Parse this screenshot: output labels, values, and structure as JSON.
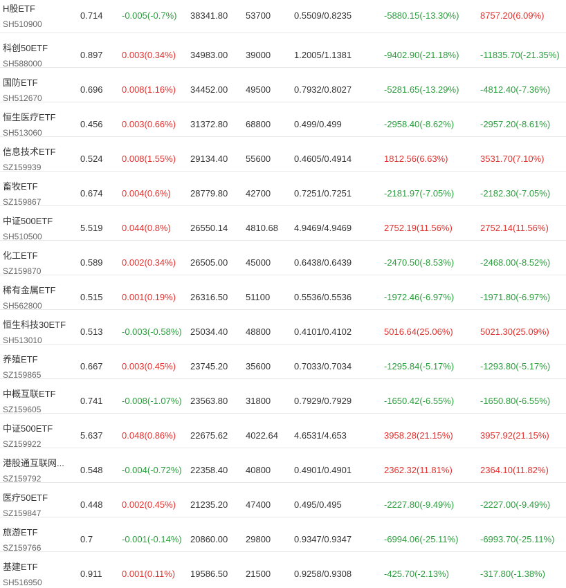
{
  "colors": {
    "up": "#e0312e",
    "down": "#2a9d3c",
    "text": "#333333",
    "subtext": "#666666",
    "divider": "#e8e8e8"
  },
  "rows": [
    {
      "name": "H股ETF",
      "code": "SH510900",
      "price": "0.714",
      "change": "-0.005(-0.7%)",
      "change_dir": "down",
      "amount": "38341.80",
      "volume": "53700",
      "ratio": "0.5509/0.8235",
      "pnl1": "-5880.15(-13.30%)",
      "pnl1_dir": "down",
      "pnl2": "8757.20(6.09%)",
      "pnl2_dir": "up"
    },
    {
      "name": "科创50ETF",
      "code": "SH588000",
      "price": "0.897",
      "change": "0.003(0.34%)",
      "change_dir": "up",
      "amount": "34983.00",
      "volume": "39000",
      "ratio": "1.2005/1.1381",
      "pnl1": "-9402.90(-21.18%)",
      "pnl1_dir": "down",
      "pnl2": "-11835.70(-21.35%)",
      "pnl2_dir": "down"
    },
    {
      "name": "国防ETF",
      "code": "SH512670",
      "price": "0.696",
      "change": "0.008(1.16%)",
      "change_dir": "up",
      "amount": "34452.00",
      "volume": "49500",
      "ratio": "0.7932/0.8027",
      "pnl1": "-5281.65(-13.29%)",
      "pnl1_dir": "down",
      "pnl2": "-4812.40(-7.36%)",
      "pnl2_dir": "down"
    },
    {
      "name": "恒生医疗ETF",
      "code": "SH513060",
      "price": "0.456",
      "change": "0.003(0.66%)",
      "change_dir": "up",
      "amount": "31372.80",
      "volume": "68800",
      "ratio": "0.499/0.499",
      "pnl1": "-2958.40(-8.62%)",
      "pnl1_dir": "down",
      "pnl2": "-2957.20(-8.61%)",
      "pnl2_dir": "down"
    },
    {
      "name": "信息技术ETF",
      "code": "SZ159939",
      "price": "0.524",
      "change": "0.008(1.55%)",
      "change_dir": "up",
      "amount": "29134.40",
      "volume": "55600",
      "ratio": "0.4605/0.4914",
      "pnl1": "1812.56(6.63%)",
      "pnl1_dir": "up",
      "pnl2": "3531.70(7.10%)",
      "pnl2_dir": "up"
    },
    {
      "name": "畜牧ETF",
      "code": "SZ159867",
      "price": "0.674",
      "change": "0.004(0.6%)",
      "change_dir": "up",
      "amount": "28779.80",
      "volume": "42700",
      "ratio": "0.7251/0.7251",
      "pnl1": "-2181.97(-7.05%)",
      "pnl1_dir": "down",
      "pnl2": "-2182.30(-7.05%)",
      "pnl2_dir": "down"
    },
    {
      "name": "中证500ETF",
      "code": "SH510500",
      "price": "5.519",
      "change": "0.044(0.8%)",
      "change_dir": "up",
      "amount": "26550.14",
      "volume": "4810.68",
      "ratio": "4.9469/4.9469",
      "pnl1": "2752.19(11.56%)",
      "pnl1_dir": "up",
      "pnl2": "2752.14(11.56%)",
      "pnl2_dir": "up"
    },
    {
      "name": "化工ETF",
      "code": "SZ159870",
      "price": "0.589",
      "change": "0.002(0.34%)",
      "change_dir": "up",
      "amount": "26505.00",
      "volume": "45000",
      "ratio": "0.6438/0.6439",
      "pnl1": "-2470.50(-8.53%)",
      "pnl1_dir": "down",
      "pnl2": "-2468.00(-8.52%)",
      "pnl2_dir": "down"
    },
    {
      "name": "稀有金属ETF",
      "code": "SH562800",
      "price": "0.515",
      "change": "0.001(0.19%)",
      "change_dir": "up",
      "amount": "26316.50",
      "volume": "51100",
      "ratio": "0.5536/0.5536",
      "pnl1": "-1972.46(-6.97%)",
      "pnl1_dir": "down",
      "pnl2": "-1971.80(-6.97%)",
      "pnl2_dir": "down"
    },
    {
      "name": "恒生科技30ETF",
      "code": "SH513010",
      "price": "0.513",
      "change": "-0.003(-0.58%)",
      "change_dir": "down",
      "amount": "25034.40",
      "volume": "48800",
      "ratio": "0.4101/0.4102",
      "pnl1": "5016.64(25.06%)",
      "pnl1_dir": "up",
      "pnl2": "5021.30(25.09%)",
      "pnl2_dir": "up"
    },
    {
      "name": "养殖ETF",
      "code": "SZ159865",
      "price": "0.667",
      "change": "0.003(0.45%)",
      "change_dir": "up",
      "amount": "23745.20",
      "volume": "35600",
      "ratio": "0.7033/0.7034",
      "pnl1": "-1295.84(-5.17%)",
      "pnl1_dir": "down",
      "pnl2": "-1293.80(-5.17%)",
      "pnl2_dir": "down"
    },
    {
      "name": "中概互联ETF",
      "code": "SZ159605",
      "price": "0.741",
      "change": "-0.008(-1.07%)",
      "change_dir": "down",
      "amount": "23563.80",
      "volume": "31800",
      "ratio": "0.7929/0.7929",
      "pnl1": "-1650.42(-6.55%)",
      "pnl1_dir": "down",
      "pnl2": "-1650.80(-6.55%)",
      "pnl2_dir": "down"
    },
    {
      "name": "中证500ETF",
      "code": "SZ159922",
      "price": "5.637",
      "change": "0.048(0.86%)",
      "change_dir": "up",
      "amount": "22675.62",
      "volume": "4022.64",
      "ratio": "4.6531/4.653",
      "pnl1": "3958.28(21.15%)",
      "pnl1_dir": "up",
      "pnl2": "3957.92(21.15%)",
      "pnl2_dir": "up"
    },
    {
      "name": "港股通互联网...",
      "code": "SZ159792",
      "price": "0.548",
      "change": "-0.004(-0.72%)",
      "change_dir": "down",
      "amount": "22358.40",
      "volume": "40800",
      "ratio": "0.4901/0.4901",
      "pnl1": "2362.32(11.81%)",
      "pnl1_dir": "up",
      "pnl2": "2364.10(11.82%)",
      "pnl2_dir": "up"
    },
    {
      "name": "医疗50ETF",
      "code": "SZ159847",
      "price": "0.448",
      "change": "0.002(0.45%)",
      "change_dir": "up",
      "amount": "21235.20",
      "volume": "47400",
      "ratio": "0.495/0.495",
      "pnl1": "-2227.80(-9.49%)",
      "pnl1_dir": "down",
      "pnl2": "-2227.00(-9.49%)",
      "pnl2_dir": "down"
    },
    {
      "name": "旅游ETF",
      "code": "SZ159766",
      "price": "0.7",
      "change": "-0.001(-0.14%)",
      "change_dir": "down",
      "amount": "20860.00",
      "volume": "29800",
      "ratio": "0.9347/0.9347",
      "pnl1": "-6994.06(-25.11%)",
      "pnl1_dir": "down",
      "pnl2": "-6993.70(-25.11%)",
      "pnl2_dir": "down"
    },
    {
      "name": "基建ETF",
      "code": "SH516950",
      "price": "0.911",
      "change": "0.001(0.11%)",
      "change_dir": "up",
      "amount": "19586.50",
      "volume": "21500",
      "ratio": "0.9258/0.9308",
      "pnl1": "-425.70(-2.13%)",
      "pnl1_dir": "down",
      "pnl2": "-317.80(-1.38%)",
      "pnl2_dir": "down"
    }
  ]
}
